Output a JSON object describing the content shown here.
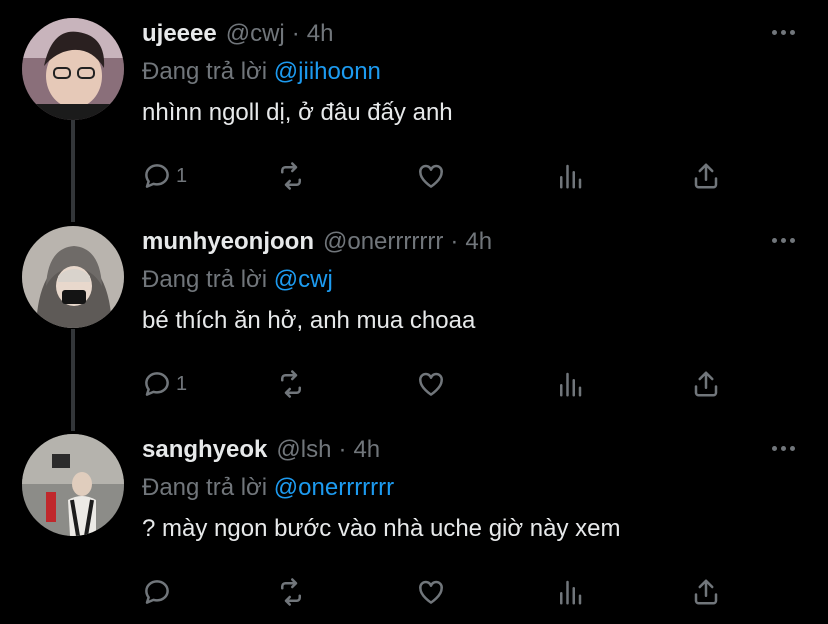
{
  "reply_prefix": "Đang trả lời",
  "tweets": [
    {
      "name": "ujeeee",
      "handle": "@cwj",
      "time": "4h",
      "reply_to": "@jiihoonn",
      "text": "nhìnn ngoll dị, ở đâu đấy anh",
      "reply_count": "1",
      "retweet_count": "",
      "like_count": ""
    },
    {
      "name": "munhyeonjoon",
      "handle": "@onerrrrrrr",
      "time": "4h",
      "reply_to": "@cwj",
      "text": "bé thích ăn hở, anh mua choaa",
      "reply_count": "1",
      "retweet_count": "",
      "like_count": ""
    },
    {
      "name": "sanghyeok",
      "handle": "@lsh",
      "time": "4h",
      "reply_to": "@onerrrrrrr",
      "text": "? mày ngon bước vào nhà uche giờ này xem",
      "reply_count": "",
      "retweet_count": "",
      "like_count": ""
    }
  ],
  "colors": {
    "background": "#000000",
    "text": "#e7e9ea",
    "muted": "#71767b",
    "link": "#1d9bf0"
  }
}
